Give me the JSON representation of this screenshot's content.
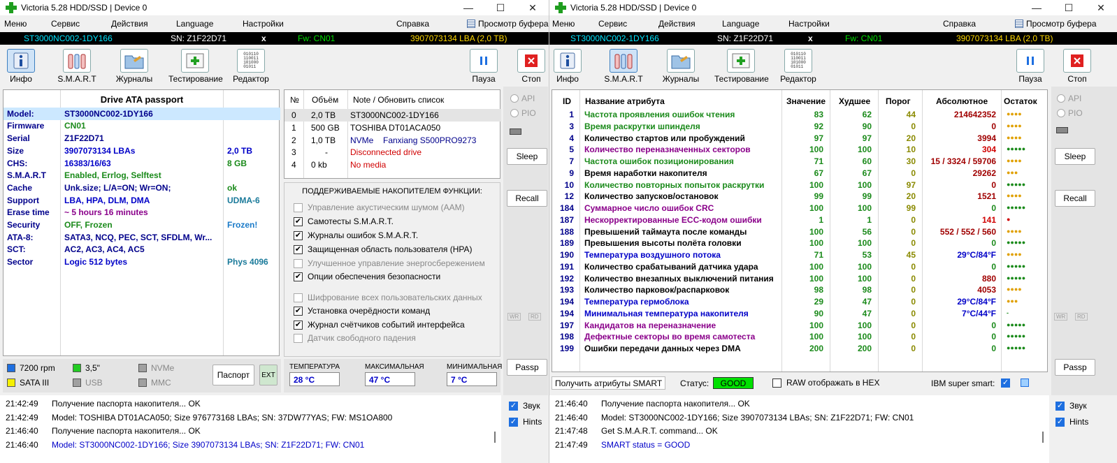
{
  "left": {
    "title": "Victoria 5.28 HDD/SSD | Device 0",
    "menu": [
      "Меню",
      "Сервис",
      "Действия",
      "Language",
      "Настройки",
      "Справка"
    ],
    "buffer_view": "Просмотр буфера",
    "device_bar": {
      "model": "ST3000NC002-1DY166",
      "sn": "SN: Z1F22D71",
      "x": "x",
      "fw": "Fw: CN01",
      "lba": "3907073134 LBA (2,0 TB)"
    },
    "toolbar": [
      {
        "label": "Инфо",
        "icon": "info-icon"
      },
      {
        "label": "S.M.A.R.T",
        "icon": "smart-bottles-icon"
      },
      {
        "label": "Журналы",
        "icon": "folder-log-icon"
      },
      {
        "label": "Тестирование",
        "icon": "test-plus-icon"
      },
      {
        "label": "Редактор",
        "icon": "hex-editor-icon"
      }
    ],
    "pause_label": "Пауза",
    "stop_label": "Стоп",
    "passport": {
      "header": "Drive ATA passport",
      "rows": [
        {
          "k": "Model:",
          "v": "ST3000NC002-1DY166",
          "e": "",
          "vc": "#00008b",
          "ec": ""
        },
        {
          "k": "Firmware",
          "v": "CN01",
          "e": "",
          "vc": "#1a8a1a",
          "ec": ""
        },
        {
          "k": "Serial",
          "v": "Z1F22D71",
          "e": "",
          "vc": "#00008b",
          "ec": ""
        },
        {
          "k": "Size",
          "v": "3907073134 LBAs",
          "e": "2,0 TB",
          "vc": "#0000c8",
          "ec": "#0000c8"
        },
        {
          "k": "CHS:",
          "v": "16383/16/63",
          "e": "8 GB",
          "vc": "#0000c8",
          "ec": "#1a8a1a"
        },
        {
          "k": "S.M.A.R.T",
          "v": "Enabled, Errlog, Selftest",
          "e": "",
          "vc": "#1a8a1a",
          "ec": ""
        },
        {
          "k": "Cache",
          "v": "Unk.size; L/A=ON; Wr=ON;",
          "e": "ok",
          "vc": "#00008b",
          "ec": "#1a8a1a"
        },
        {
          "k": "Support",
          "v": "LBA, HPA, DLM, DMA",
          "e": "UDMA-6",
          "vc": "#0000c8",
          "ec": "#1a7a9a"
        },
        {
          "k": "Erase time",
          "v": "~ 5 hours 16 minutes",
          "e": "",
          "vc": "#8a008a",
          "ec": ""
        },
        {
          "k": "Security",
          "v": "OFF, Frozen",
          "e": "Frozen!",
          "vc": "#1a8a1a",
          "ec": "#1a7ac8"
        },
        {
          "k": "ATA-8:",
          "v": "SATA3, NCQ, PEC, SCT, SFDLM, Wr...",
          "e": "",
          "vc": "#00008b",
          "ec": ""
        },
        {
          "k": "SCT:",
          "v": "AC2, AC3, AC4, AC5",
          "e": "",
          "vc": "#00008b",
          "ec": ""
        },
        {
          "k": "Sector",
          "v": "Logic 512 bytes",
          "e": "Phys 4096",
          "vc": "#0000c8",
          "ec": "#1a7a9a"
        }
      ]
    },
    "devices": {
      "headers": [
        "№",
        "Объём",
        "Note / Обновить список"
      ],
      "rows": [
        {
          "n": "0",
          "size": "2,0 TB",
          "note": "ST3000NC002-1DY166",
          "extra": "",
          "nc": "#000"
        },
        {
          "n": "1",
          "size": "500 GB",
          "note": "TOSHIBA DT01ACA050",
          "extra": "",
          "nc": "#000"
        },
        {
          "n": "2",
          "size": "1,0 TB",
          "note": "NVMe",
          "extra": "Fanxiang S500PRO9273",
          "nc": "#00008b"
        },
        {
          "n": "3",
          "size": "-",
          "note": "Disconnected drive",
          "extra": "",
          "nc": "#d00000"
        },
        {
          "n": "4",
          "size": "0 kb",
          "note": "No media",
          "extra": "",
          "nc": "#d00000"
        }
      ]
    },
    "features": {
      "title": "ПОДДЕРЖИВАЕМЫЕ НАКОПИТЕЛЕМ ФУНКЦИИ:",
      "items": [
        {
          "label": "Управление акустическим шумом (AAM)",
          "checked": false,
          "enabled": false
        },
        {
          "label": "Самотесты S.M.A.R.T.",
          "checked": true,
          "enabled": true
        },
        {
          "label": "Журналы ошибок S.M.A.R.T.",
          "checked": true,
          "enabled": true
        },
        {
          "label": "Защищенная область пользователя (HPA)",
          "checked": true,
          "enabled": true
        },
        {
          "label": "Улучшенное управление энергосбережением",
          "checked": false,
          "enabled": false
        },
        {
          "label": "Опции обеспечения безопасности",
          "checked": true,
          "enabled": true
        },
        {
          "label": "Шифрование всех пользовательских данных",
          "checked": false,
          "enabled": false
        },
        {
          "label": "Установка очерёдности команд",
          "checked": true,
          "enabled": true
        },
        {
          "label": "Журнал счётчиков событий интерфейса",
          "checked": true,
          "enabled": true
        },
        {
          "label": "Датчик свободного падения",
          "checked": false,
          "enabled": false
        }
      ]
    },
    "side": {
      "api": "API",
      "pio": "PIO",
      "sleep": "Sleep",
      "recall": "Recall",
      "wr": "WR",
      "rd": "RD",
      "passp": "Passp",
      "sound": "Звук",
      "hints": "Hints"
    },
    "legend": [
      {
        "label": "7200 rpm",
        "color": "#1e6fe0",
        "dis": false
      },
      {
        "label": "3,5\"",
        "color": "#22cc22",
        "dis": false
      },
      {
        "label": "NVMe",
        "color": "#a0a0a0",
        "dis": true
      },
      {
        "label": "SATA III",
        "color": "#f5f000",
        "dis": false
      },
      {
        "label": "USB",
        "color": "#a0a0a0",
        "dis": true
      },
      {
        "label": "MMC",
        "color": "#a0a0a0",
        "dis": true
      }
    ],
    "passport_btn": "Паспорт",
    "ext_btn": "EXT",
    "temps": [
      {
        "label": "ТЕМПЕРАТУРА",
        "value": "28 °C"
      },
      {
        "label": "МАКСИМАЛЬНАЯ",
        "value": "47 °C"
      },
      {
        "label": "МИНИМАЛЬНАЯ",
        "value": "7 °C"
      }
    ],
    "log": [
      {
        "t": "21:42:49",
        "m": "Получение паспорта накопителя... OK",
        "c": "#000"
      },
      {
        "t": "21:42:49",
        "m": "Model: TOSHIBA DT01ACA050; Size 976773168 LBAs; SN: 37DW77YAS; FW: MS1OA800",
        "c": "#000"
      },
      {
        "t": "21:46:40",
        "m": "Получение паспорта накопителя... OK",
        "c": "#000"
      },
      {
        "t": "21:46:40",
        "m": "Model: ST3000NC002-1DY166; Size 3907073134 LBAs; SN: Z1F22D71; FW: CN01",
        "c": "#0000c8"
      }
    ]
  },
  "right": {
    "title": "Victoria 5.28 HDD/SSD | Device 0",
    "menu": [
      "Меню",
      "Сервис",
      "Действия",
      "Language",
      "Настройки",
      "Справка"
    ],
    "buffer_view": "Просмотр буфера",
    "device_bar": {
      "model": "ST3000NC002-1DY166",
      "sn": "SN: Z1F22D71",
      "x": "x",
      "fw": "Fw: CN01",
      "lba": "3907073134 LBA (2,0 TB)"
    },
    "toolbar": [
      {
        "label": "Инфо",
        "icon": "info-icon"
      },
      {
        "label": "S.M.A.R.T",
        "icon": "smart-bottles-icon"
      },
      {
        "label": "Журналы",
        "icon": "folder-log-icon"
      },
      {
        "label": "Тестирование",
        "icon": "test-plus-icon"
      },
      {
        "label": "Редактор",
        "icon": "hex-editor-icon"
      }
    ],
    "pause_label": "Пауза",
    "stop_label": "Стоп",
    "smart": {
      "headers": [
        "ID",
        "Название атрибута",
        "Значение",
        "Худшее",
        "Порог",
        "Абсолютное",
        "Остаток"
      ],
      "rows": [
        {
          "id": "1",
          "name": "Частота проявления ошибок чтения",
          "val": "83",
          "worst": "62",
          "thr": "44",
          "abs": "214642352",
          "rem": "●●●●",
          "nc": "#1a8a1a",
          "ac": "#a00000",
          "rc": "#e0a000"
        },
        {
          "id": "3",
          "name": "Время раскрутки шпинделя",
          "val": "92",
          "worst": "90",
          "thr": "0",
          "abs": "0",
          "rem": "●●●●",
          "nc": "#1a8a1a",
          "ac": "#a00000",
          "rc": "#e0a000"
        },
        {
          "id": "4",
          "name": "Количество стартов или пробуждений",
          "val": "97",
          "worst": "97",
          "thr": "20",
          "abs": "3994",
          "rem": "●●●●",
          "nc": "#000",
          "ac": "#a00000",
          "rc": "#e0a000"
        },
        {
          "id": "5",
          "name": "Количество переназначенных секторов",
          "val": "100",
          "worst": "100",
          "thr": "10",
          "abs": "304",
          "rem": "●●●●●",
          "nc": "#8a008a",
          "ac": "#d00000",
          "rc": "#1a8a1a"
        },
        {
          "id": "7",
          "name": "Частота ошибок позиционирования",
          "val": "71",
          "worst": "60",
          "thr": "30",
          "abs": "15 / 3324 / 59706",
          "rem": "●●●●",
          "nc": "#1a8a1a",
          "ac": "#a00000",
          "rc": "#e0a000"
        },
        {
          "id": "9",
          "name": "Время наработки накопителя",
          "val": "67",
          "worst": "67",
          "thr": "0",
          "abs": "29262",
          "rem": "●●●",
          "nc": "#000",
          "ac": "#a00000",
          "rc": "#e0a000"
        },
        {
          "id": "10",
          "name": "Количество повторных попыток раскрутки",
          "val": "100",
          "worst": "100",
          "thr": "97",
          "abs": "0",
          "rem": "●●●●●",
          "nc": "#1a8a1a",
          "ac": "#a00000",
          "rc": "#1a8a1a"
        },
        {
          "id": "12",
          "name": "Количество запусков/остановок",
          "val": "99",
          "worst": "99",
          "thr": "20",
          "abs": "1521",
          "rem": "●●●●",
          "nc": "#000",
          "ac": "#a00000",
          "rc": "#e0a000"
        },
        {
          "id": "184",
          "name": "Суммарное число ошибок CRC",
          "val": "100",
          "worst": "100",
          "thr": "99",
          "abs": "0",
          "rem": "●●●●●",
          "nc": "#8a008a",
          "ac": "#1a8a1a",
          "rc": "#1a8a1a"
        },
        {
          "id": "187",
          "name": "Нескорректированные ECC-кодом ошибки",
          "val": "1",
          "worst": "1",
          "thr": "0",
          "abs": "141",
          "rem": "●",
          "nc": "#8a008a",
          "ac": "#d00000",
          "rc": "#d00000"
        },
        {
          "id": "188",
          "name": "Превышений таймаута после команды",
          "val": "100",
          "worst": "56",
          "thr": "0",
          "abs": "552 / 552 / 560",
          "rem": "●●●●",
          "nc": "#000",
          "ac": "#a00000",
          "rc": "#e0a000"
        },
        {
          "id": "189",
          "name": "Превышения высоты полёта головки",
          "val": "100",
          "worst": "100",
          "thr": "0",
          "abs": "0",
          "rem": "●●●●●",
          "nc": "#000",
          "ac": "#1a8a1a",
          "rc": "#1a8a1a"
        },
        {
          "id": "190",
          "name": "Температура воздушного потока",
          "val": "71",
          "worst": "53",
          "thr": "45",
          "abs": "29°C/84°F",
          "rem": "●●●●",
          "nc": "#0000c8",
          "ac": "#0000c8",
          "rc": "#e0a000"
        },
        {
          "id": "191",
          "name": "Количество срабатываний датчика удара",
          "val": "100",
          "worst": "100",
          "thr": "0",
          "abs": "0",
          "rem": "●●●●●",
          "nc": "#000",
          "ac": "#1a8a1a",
          "rc": "#1a8a1a"
        },
        {
          "id": "192",
          "name": "Количество внезапных выключений питания",
          "val": "100",
          "worst": "100",
          "thr": "0",
          "abs": "880",
          "rem": "●●●●●",
          "nc": "#000",
          "ac": "#a00000",
          "rc": "#1a8a1a"
        },
        {
          "id": "193",
          "name": "Количество парковок/распарковок",
          "val": "98",
          "worst": "98",
          "thr": "0",
          "abs": "4053",
          "rem": "●●●●",
          "nc": "#000",
          "ac": "#a00000",
          "rc": "#e0a000"
        },
        {
          "id": "194",
          "name": "Температура гермоблока",
          "val": "29",
          "worst": "47",
          "thr": "0",
          "abs": "29°C/84°F",
          "rem": "●●●",
          "nc": "#0000c8",
          "ac": "#0000c8",
          "rc": "#e0a000"
        },
        {
          "id": "194",
          "name": "Минимальная температура накопителя",
          "val": "90",
          "worst": "47",
          "thr": "0",
          "abs": "7°C/44°F",
          "rem": "-",
          "nc": "#0000c8",
          "ac": "#0000c8",
          "rc": "#1a8a1a"
        },
        {
          "id": "197",
          "name": "Кандидатов на переназначение",
          "val": "100",
          "worst": "100",
          "thr": "0",
          "abs": "0",
          "rem": "●●●●●",
          "nc": "#8a008a",
          "ac": "#1a8a1a",
          "rc": "#1a8a1a"
        },
        {
          "id": "198",
          "name": "Дефектные секторы во время самотеста",
          "val": "100",
          "worst": "100",
          "thr": "0",
          "abs": "0",
          "rem": "●●●●●",
          "nc": "#8a008a",
          "ac": "#1a8a1a",
          "rc": "#1a8a1a"
        },
        {
          "id": "199",
          "name": "Ошибки передачи данных через DMA",
          "val": "200",
          "worst": "200",
          "thr": "0",
          "abs": "0",
          "rem": "●●●●●",
          "nc": "#000",
          "ac": "#1a8a1a",
          "rc": "#1a8a1a"
        }
      ]
    },
    "get_smart_btn": "Получить атрибуты SMART",
    "status_label": "Статус:",
    "status_value": "GOOD",
    "raw_hex_label": "RAW отображать в HEX",
    "ibm_label": "IBM super smart:",
    "side": {
      "api": "API",
      "pio": "PIO",
      "sleep": "Sleep",
      "recall": "Recall",
      "wr": "WR",
      "rd": "RD",
      "passp": "Passp",
      "sound": "Звук",
      "hints": "Hints"
    },
    "log": [
      {
        "t": "21:46:40",
        "m": "Получение паспорта накопителя... OK",
        "c": "#000"
      },
      {
        "t": "21:46:40",
        "m": "Model: ST3000NC002-1DY166; Size 3907073134 LBAs; SN: Z1F22D71; FW: CN01",
        "c": "#000"
      },
      {
        "t": "21:47:48",
        "m": "Get S.M.A.R.T. command... OK",
        "c": "#000"
      },
      {
        "t": "21:47:49",
        "m": "SMART status = GOOD",
        "c": "#0000c8"
      }
    ]
  },
  "colors": {
    "devbar_model": "#00e5ff",
    "devbar_sn": "#ffffff",
    "devbar_fw": "#00e000",
    "devbar_lba": "#ffd800",
    "status_good": "#00e000"
  }
}
